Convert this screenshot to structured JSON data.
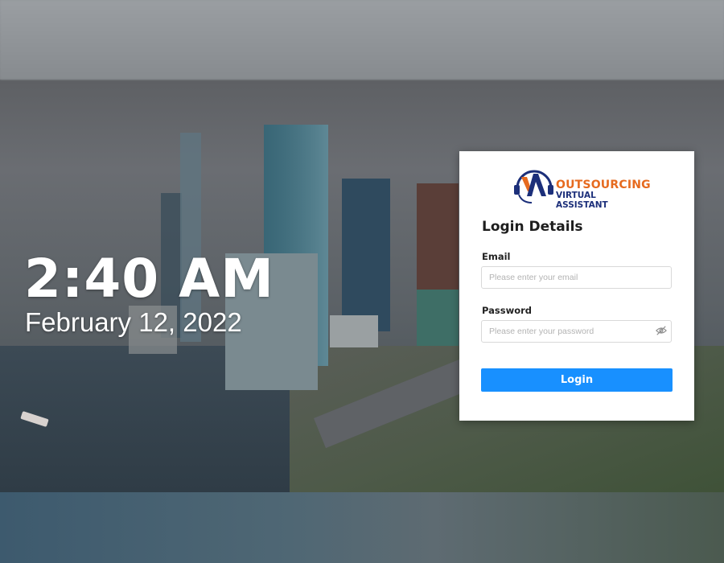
{
  "lockscreen": {
    "time": "2:40 AM",
    "date": "February 12, 2022"
  },
  "login": {
    "logo": {
      "line1": "OUTSOURCING",
      "line2": "VIRTUAL ASSISTANT",
      "icon": "headset-va-logo-icon"
    },
    "title": "Login Details",
    "email_label": "Email",
    "email_placeholder": "Please enter your email",
    "email_value": "",
    "password_label": "Password",
    "password_placeholder": "Please enter your password",
    "password_value": "",
    "password_toggle_icon": "eye-slash-icon",
    "submit_label": "Login"
  },
  "colors": {
    "accent": "#1890ff",
    "logo_orange": "#e66a1f",
    "logo_navy": "#1c2f7a"
  }
}
